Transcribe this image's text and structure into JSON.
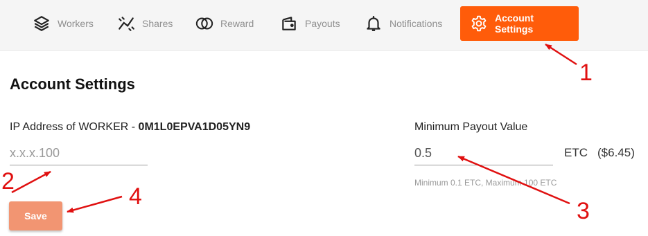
{
  "nav": {
    "items": [
      {
        "label": "Workers",
        "icon": "layers-icon"
      },
      {
        "label": "Shares",
        "icon": "trend-chart-icon"
      },
      {
        "label": "Reward",
        "icon": "coins-icon"
      },
      {
        "label": "Payouts",
        "icon": "wallet-icon"
      },
      {
        "label": "Notifications",
        "icon": "bell-icon"
      },
      {
        "label": "Account Settings",
        "icon": "gear-icon",
        "active": true
      }
    ]
  },
  "main": {
    "title": "Account Settings",
    "ip_field": {
      "label": "IP Address of WORKER - ",
      "worker_id": "0M1L0EPVA1D05YN9",
      "placeholder": "x.x.x.100"
    },
    "payout_field": {
      "label": "Minimum Payout Value",
      "value": "0.5",
      "unit": "ETC",
      "fiat": "($6.45)",
      "hint": "Minimum 0.1 ETC, Maximum 100 ETC"
    },
    "save_label": "Save"
  },
  "annotations": {
    "labels": [
      "1",
      "2",
      "3",
      "4"
    ],
    "color": "#e01010"
  },
  "colors": {
    "accent": "#ff5c0a",
    "save_button": "#f29572"
  }
}
